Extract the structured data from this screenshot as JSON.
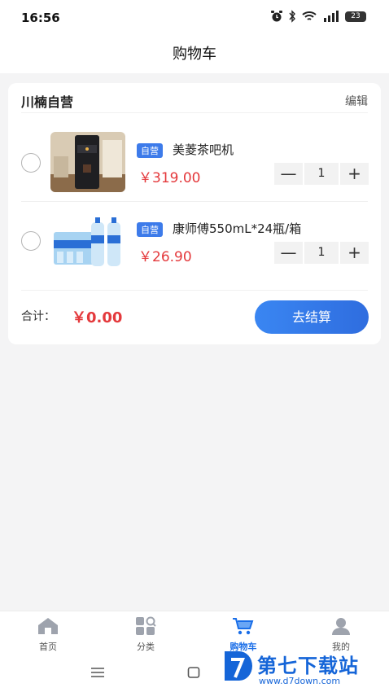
{
  "status_bar": {
    "time": "16:56",
    "battery": "23"
  },
  "header": {
    "title": "购物车"
  },
  "cart": {
    "store_name": "川楠自营",
    "edit_label": "编辑",
    "items": [
      {
        "tag": "自营",
        "name": "美菱茶吧机",
        "price": "￥319.00",
        "quantity": "1",
        "selected": false
      },
      {
        "tag": "自营",
        "name": "康师傅550mL*24瓶/箱",
        "price": "￥26.90",
        "quantity": "1",
        "selected": false
      }
    ],
    "minus_symbol": "—",
    "plus_symbol": "+",
    "total_label": "合计：",
    "total_value": "￥0.00",
    "checkout_label": "去结算"
  },
  "tabbar": {
    "tabs": [
      {
        "label": "首页",
        "icon": "home-icon",
        "active": false
      },
      {
        "label": "分类",
        "icon": "category-icon",
        "active": false
      },
      {
        "label": "购物车",
        "icon": "cart-icon",
        "active": true
      },
      {
        "label": "我的",
        "icon": "profile-icon",
        "active": false
      }
    ]
  },
  "watermark": {
    "name": "第七下载站",
    "url": "www.d7down.com"
  },
  "colors": {
    "accent": "#2f6ddf",
    "price": "#e4393c",
    "tag": "#3d7bea"
  }
}
